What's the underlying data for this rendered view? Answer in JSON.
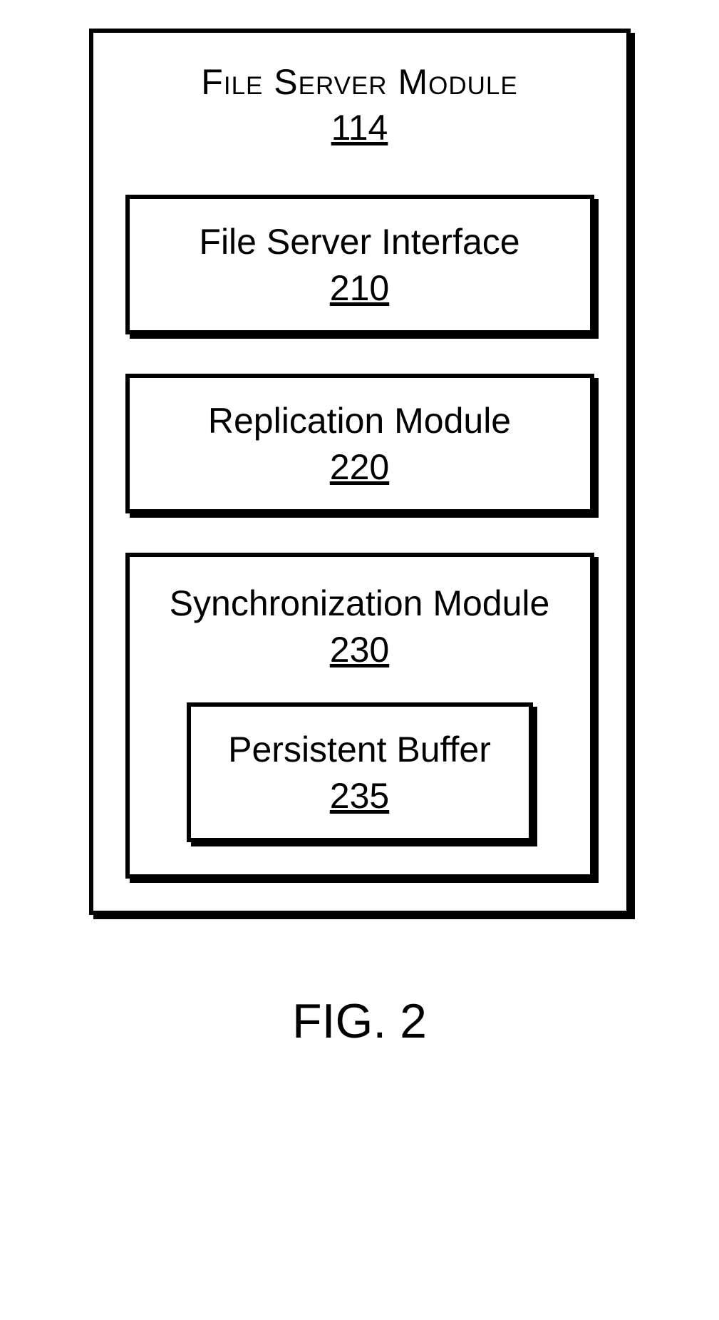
{
  "outer": {
    "title": "File Server Module",
    "ref": "114"
  },
  "file_server_interface": {
    "label": "File Server Interface",
    "ref": "210"
  },
  "replication_module": {
    "label": "Replication Module",
    "ref": "220"
  },
  "synchronization_module": {
    "label": "Synchronization Module",
    "ref": "230"
  },
  "persistent_buffer": {
    "label": "Persistent Buffer",
    "ref": "235"
  },
  "caption": "FIG. 2"
}
